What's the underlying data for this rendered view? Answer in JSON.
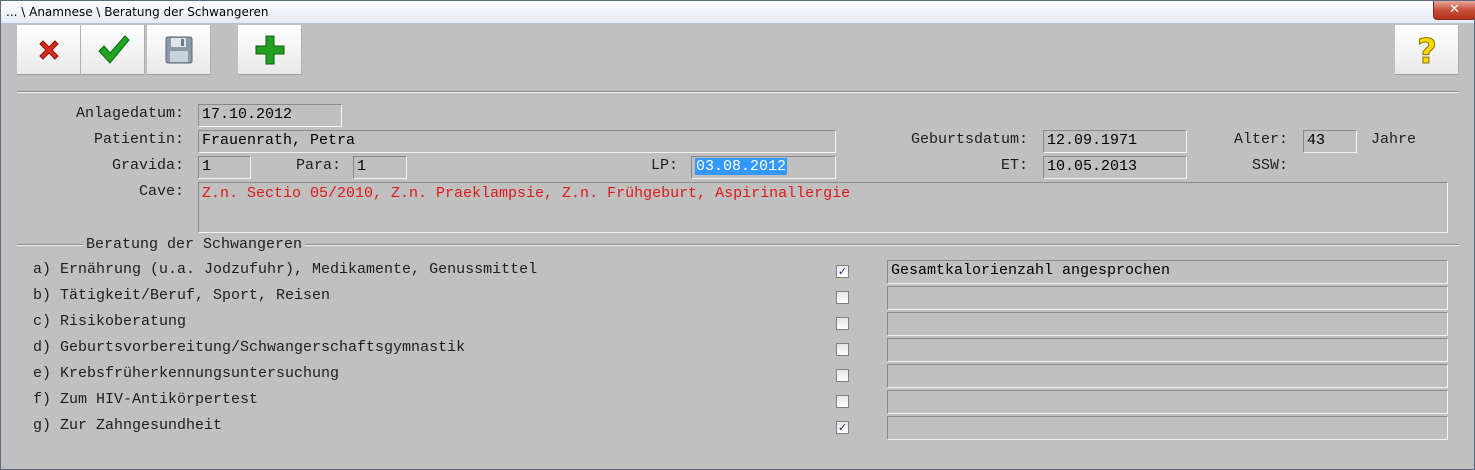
{
  "window": {
    "title": "... \\ Anamnese \\ Beratung der Schwangeren",
    "close_glyph": "✕"
  },
  "toolbar": {
    "buttons": [
      {
        "name": "cancel",
        "icon": "red-x-icon"
      },
      {
        "name": "confirm",
        "icon": "green-checkmark-icon"
      },
      {
        "name": "save",
        "icon": "floppy-disk-icon"
      },
      {
        "name": "add",
        "icon": "green-plus-icon"
      },
      {
        "name": "help",
        "icon": "yellow-question-icon"
      }
    ]
  },
  "header": {
    "anlagedatum_label": "Anlagedatum:",
    "anlagedatum": "17.10.2012",
    "patientin_label": "Patientin:",
    "patientin": "Frauenrath, Petra",
    "geburtsdatum_label": "Geburtsdatum:",
    "geburtsdatum": "12.09.1971",
    "alter_label": "Alter:",
    "alter": "43",
    "alter_unit": "Jahre",
    "gravida_label": "Gravida:",
    "gravida": "1",
    "para_label": "Para:",
    "para": "1",
    "lp_label": "LP:",
    "lp": "03.08.2012",
    "et_label": "ET:",
    "et": "10.05.2013",
    "ssw_label": "SSW:",
    "cave_label": "Cave:",
    "cave": "Z.n. Sectio 05/2010, Z.n. Praeklampsie, Z.n. Frühgeburt, Aspirinallergie"
  },
  "beratung": {
    "title": "Beratung der Schwangeren",
    "items": [
      {
        "label": "a) Ernährung (u.a. Jodzufuhr), Medikamente, Genussmittel",
        "checked": true,
        "note": "Gesamtkalorienzahl angesprochen"
      },
      {
        "label": "b) Tätigkeit/Beruf, Sport, Reisen",
        "checked": false,
        "note": ""
      },
      {
        "label": "c) Risikoberatung",
        "checked": false,
        "note": ""
      },
      {
        "label": "d) Geburtsvorbereitung/Schwangerschaftsgymnastik",
        "checked": false,
        "note": ""
      },
      {
        "label": "e) Krebsfrüherkennungsuntersuchung",
        "checked": false,
        "note": ""
      },
      {
        "label": "f) Zum HIV-Antikörpertest",
        "checked": false,
        "note": ""
      },
      {
        "label": "g) Zur Zahngesundheit",
        "checked": true,
        "note": ""
      }
    ]
  },
  "colors": {
    "background": "#c0c0c0",
    "cave_text": "#e01818",
    "selection": "#3399ff"
  }
}
